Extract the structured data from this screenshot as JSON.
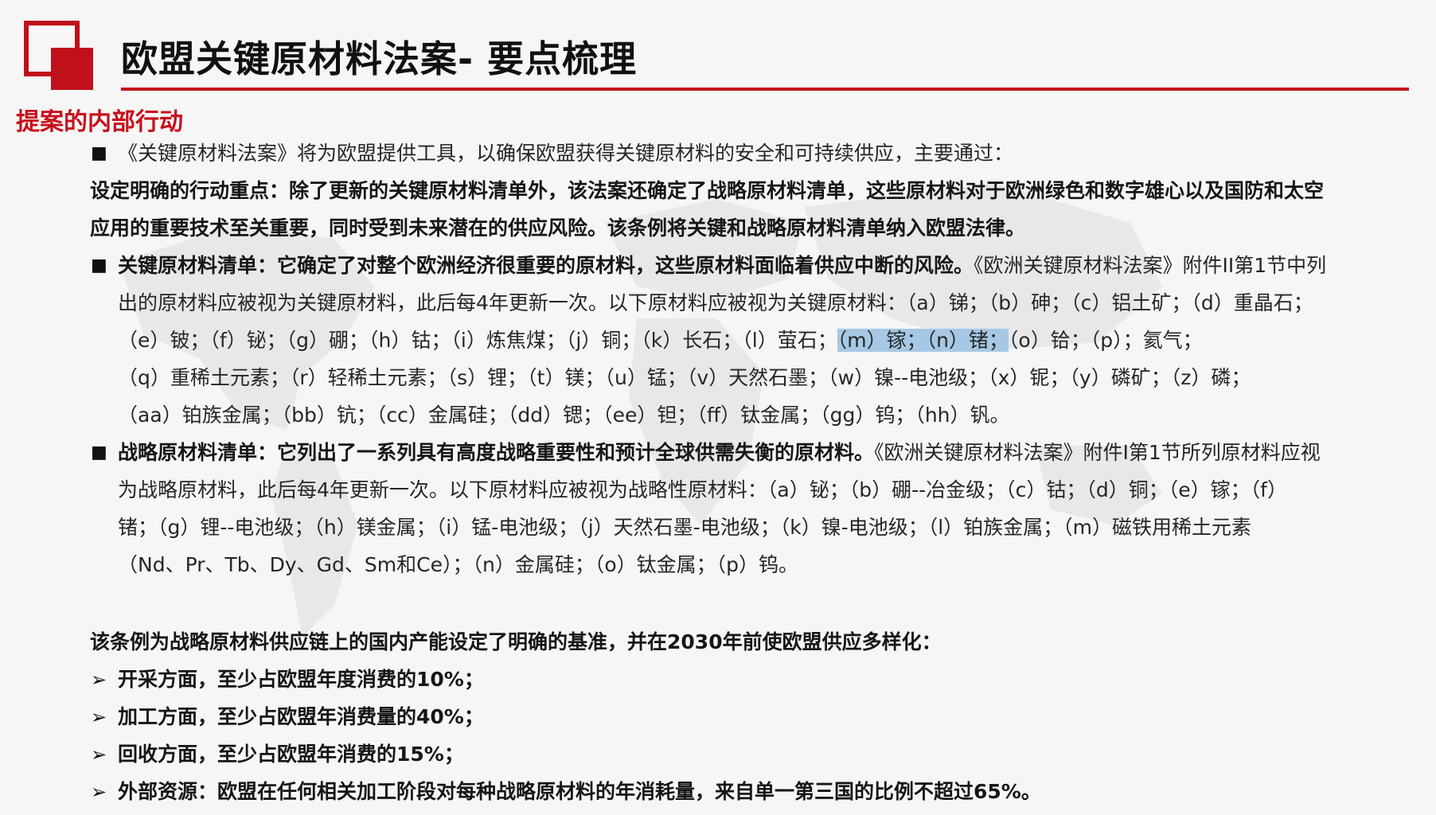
{
  "header": {
    "title": "欧盟关键原材料法案- 要点梳理",
    "section_title": "提案的内部行动",
    "accent_color": "#c8101c"
  },
  "body": {
    "intro": "《关键原材料法案》将为欧盟提供工具，以确保欧盟获得关键原材料的安全和可持续供应，主要通过：",
    "priority_line1": "设定明确的行动重点：除了更新的关键原材料清单外，该法案还确定了战略原材料清单，这些原材料对于欧洲绿色和数字雄心以及国防和太空",
    "priority_line2": "应用的重要技术至关重要，同时受到未来潜在的供应风险。该条例将关键和战略原材料清单纳入欧盟法律。",
    "critical": {
      "lead": "关键原材料清单：它确定了对整个欧洲经济很重要的原材料，这些原材料面临着供应中断的风险。",
      "l1_tail": "《欧洲关键原材料法案》附件II第1节中列",
      "l2": "出的原材料应被视为关键原材料，此后每4年更新一次。以下原材料应被视为关键原材料：（a）锑；（b）砷；（c）铝土矿；（d）重晶石；",
      "l3_pre": "（e）铍；（f）铋；（g）硼；（h）钴；（i）炼焦煤；（j）铜；（k）长石；（l）萤石；",
      "l3_highlight": "（m）镓；（n）锗；",
      "l3_post": "（o）铪；（p）；氦气；",
      "l4": "（q）重稀土元素；（r）轻稀土元素；（s）锂；（t）镁；（u）锰；（v）天然石墨；（w）镍--电池级；（x）铌；（y）磷矿；（z）磷；",
      "l5": "（aa）铂族金属；（bb）钪；（cc）金属硅；（dd）锶；（ee）钽；（ff）钛金属；（gg）钨；（hh）钒。"
    },
    "strategic": {
      "lead": "战略原材料清单：它列出了一系列具有高度战略重要性和预计全球供需失衡的原材料。",
      "l1_tail": "《欧洲关键原材料法案》附件I第1节所列原材料应视",
      "l2": "为战略原材料，此后每4年更新一次。以下原材料应被视为战略性原材料：（a）铋；（b）硼--冶金级；（c）钴；（d）铜；（e）镓；（f）",
      "l3": "锗；（g）锂--电池级；（h）镁金属；（i）锰-电池级；（j）天然石墨-电池级；（k）镍-电池级；（l）铂族金属；（m）磁铁用稀土元素",
      "l4": "（Nd、Pr、Tb、Dy、Gd、Sm和Ce）；（n）金属硅；（o）钛金属；（p）钨。"
    },
    "benchmark_intro": "该条例为战略原材料供应链上的国内产能设定了明确的基准，并在2030年前使欧盟供应多样化：",
    "benchmarks": [
      "开采方面，至少占欧盟年度消费的10%；",
      "加工方面，至少占欧盟年消费量的40%；",
      "回收方面，至少占欧盟年消费的15%；",
      "外部资源：欧盟在任何相关加工阶段对每种战略原材料的年消耗量，来自单一第三国的比例不超过65%。"
    ],
    "bullet_glyph": "■",
    "arrow_glyph": "➢",
    "highlight_color": "#a6c8e4"
  }
}
